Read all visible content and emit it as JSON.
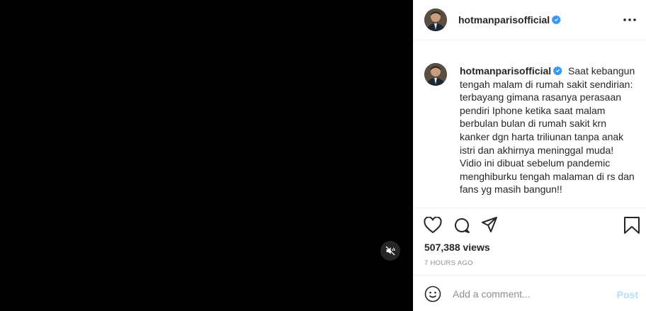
{
  "post": {
    "username": "hotmanparisofficial",
    "verified": true,
    "caption": "Saat kebangun tengah malam di rumah sakit sendirian: terbayang gimana rasanya perasaan pendiri Iphone ketika saat malam berbulan bulan di rumah sakit krn kanker dgn harta triliunan tanpa anak istri dan akhirnya meninggal muda! Vidio ini dibuat sebelum pandemic menghiburku tengah malaman di rs dan fans yg masih bangun!!",
    "views": {
      "count": "507,388",
      "label": "views"
    },
    "time_ago": "7 HOURS AGO"
  },
  "icons": {
    "mute": "muted-speaker-icon",
    "more": "more-options-icon",
    "like": "heart-icon",
    "comment": "comment-bubble-icon",
    "share": "paper-plane-icon",
    "save": "bookmark-icon",
    "emoji": "smiley-icon",
    "verified": "verified-badge-icon"
  },
  "comment_box": {
    "placeholder": "Add a comment...",
    "post_label": "Post"
  },
  "colors": {
    "video_background": "#000000",
    "verified_blue": "#3897f0",
    "post_disabled": "#b2dffc",
    "text_primary": "#262626",
    "text_secondary": "#8e8e8e",
    "divider": "#efefef"
  }
}
